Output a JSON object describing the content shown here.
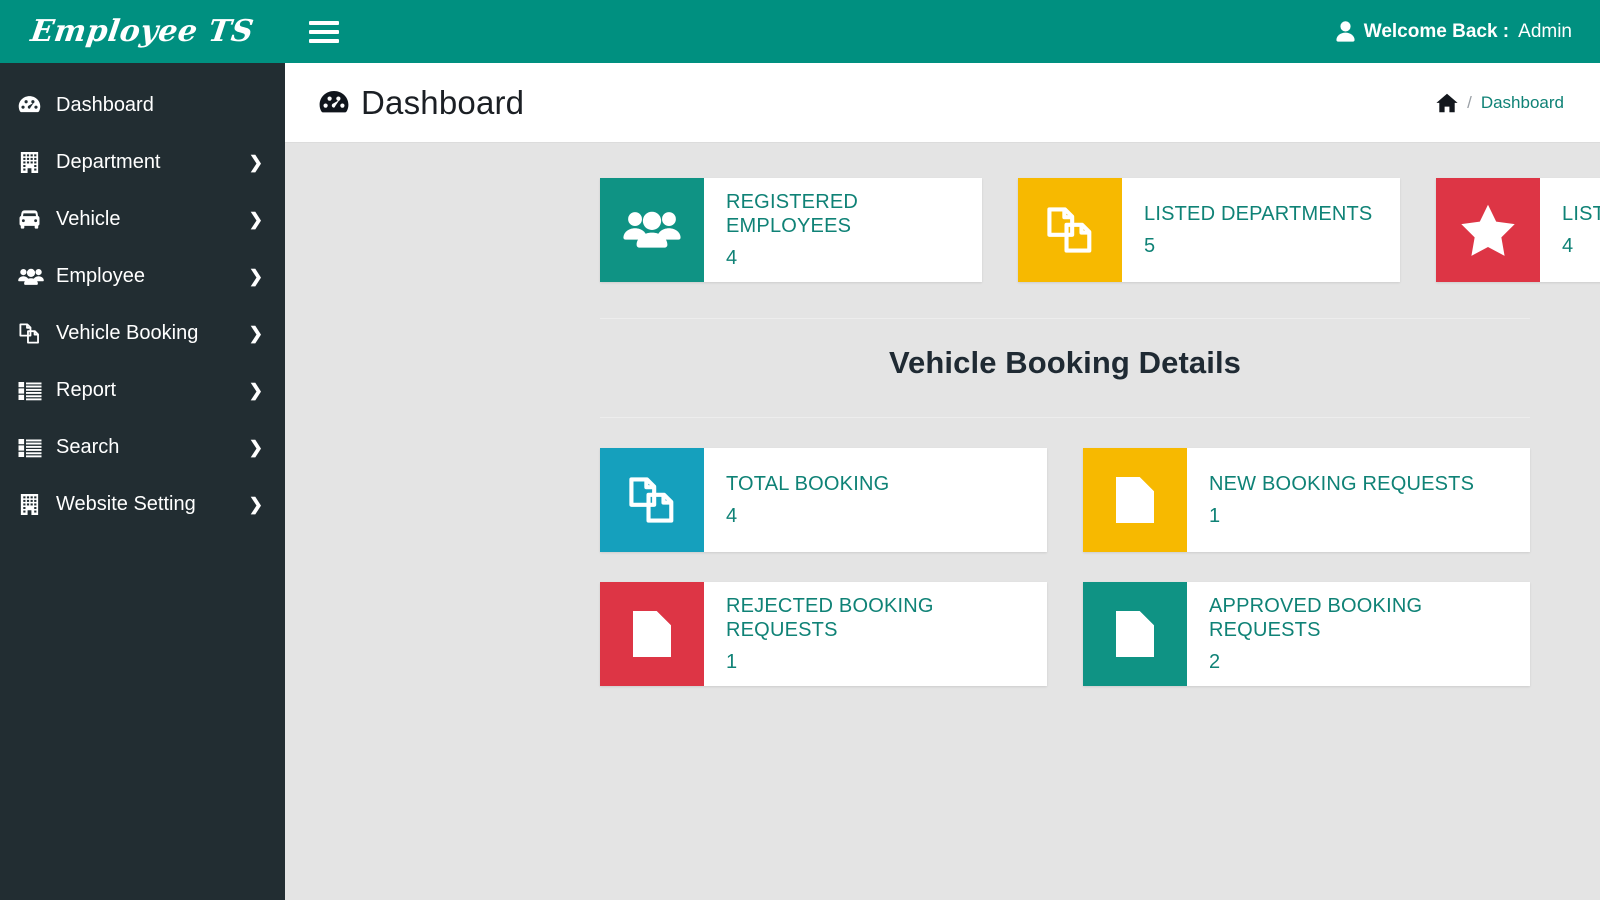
{
  "brand": {
    "text": "Employee TS"
  },
  "colors": {
    "teal": "#009080",
    "teal_dark": "#0f8276",
    "sidebar": "#222d32",
    "yellow": "#f7b900",
    "red": "#dd3545",
    "cyan": "#15a0bd",
    "green": "#0f9384",
    "content_bg": "#e4e4e4"
  },
  "topbar": {
    "menu_toggle": "hamburger-menu",
    "welcome_prefix": "Welcome Back :",
    "welcome_user": "Admin"
  },
  "page": {
    "title": "Dashboard",
    "title_icon": "tachometer-icon"
  },
  "breadcrumb": {
    "home_icon": "home-icon",
    "separator": "/",
    "current": "Dashboard"
  },
  "sidebar": {
    "items": [
      {
        "label": "Dashboard",
        "icon": "tachometer-icon",
        "caret": false,
        "name": "dashboard"
      },
      {
        "label": "Department",
        "icon": "building-icon",
        "caret": true,
        "name": "department"
      },
      {
        "label": "Vehicle",
        "icon": "car-icon",
        "caret": true,
        "name": "vehicle"
      },
      {
        "label": "Employee",
        "icon": "users-icon",
        "caret": true,
        "name": "employee"
      },
      {
        "label": "Vehicle Booking",
        "icon": "clone-icon",
        "caret": true,
        "name": "vehicle-booking"
      },
      {
        "label": "Report",
        "icon": "list-icon",
        "caret": true,
        "name": "report"
      },
      {
        "label": "Search",
        "icon": "list-icon",
        "caret": true,
        "name": "search"
      },
      {
        "label": "Website Setting",
        "icon": "building-icon",
        "caret": true,
        "name": "website-setting"
      }
    ],
    "caret_glyph": "❯"
  },
  "stats_row1": [
    {
      "label": "REGISTERED EMPLOYEES",
      "value": "4",
      "icon": "users-icon",
      "color": "#0f9384"
    },
    {
      "label": "LISTED DEPARTMENTS",
      "value": "5",
      "icon": "clone-icon",
      "color": "#f7b900"
    },
    {
      "label": "LISTED VEHICLE",
      "value": "4",
      "icon": "star-icon",
      "color": "#dd3545"
    }
  ],
  "section": {
    "title": "Vehicle Booking Details"
  },
  "stats_row2": [
    {
      "label": "TOTAL BOOKING",
      "value": "4",
      "icon": "clone-icon",
      "color": "#15a0bd"
    },
    {
      "label": "NEW BOOKING REQUESTS",
      "value": "1",
      "icon": "file-icon",
      "color": "#f7b900"
    }
  ],
  "stats_row3": [
    {
      "label": "REJECTED BOOKING REQUESTS",
      "value": "1",
      "icon": "file-icon",
      "color": "#dd3545"
    },
    {
      "label": "APPROVED BOOKING REQUESTS",
      "value": "2",
      "icon": "file-icon",
      "color": "#0f9384"
    }
  ]
}
